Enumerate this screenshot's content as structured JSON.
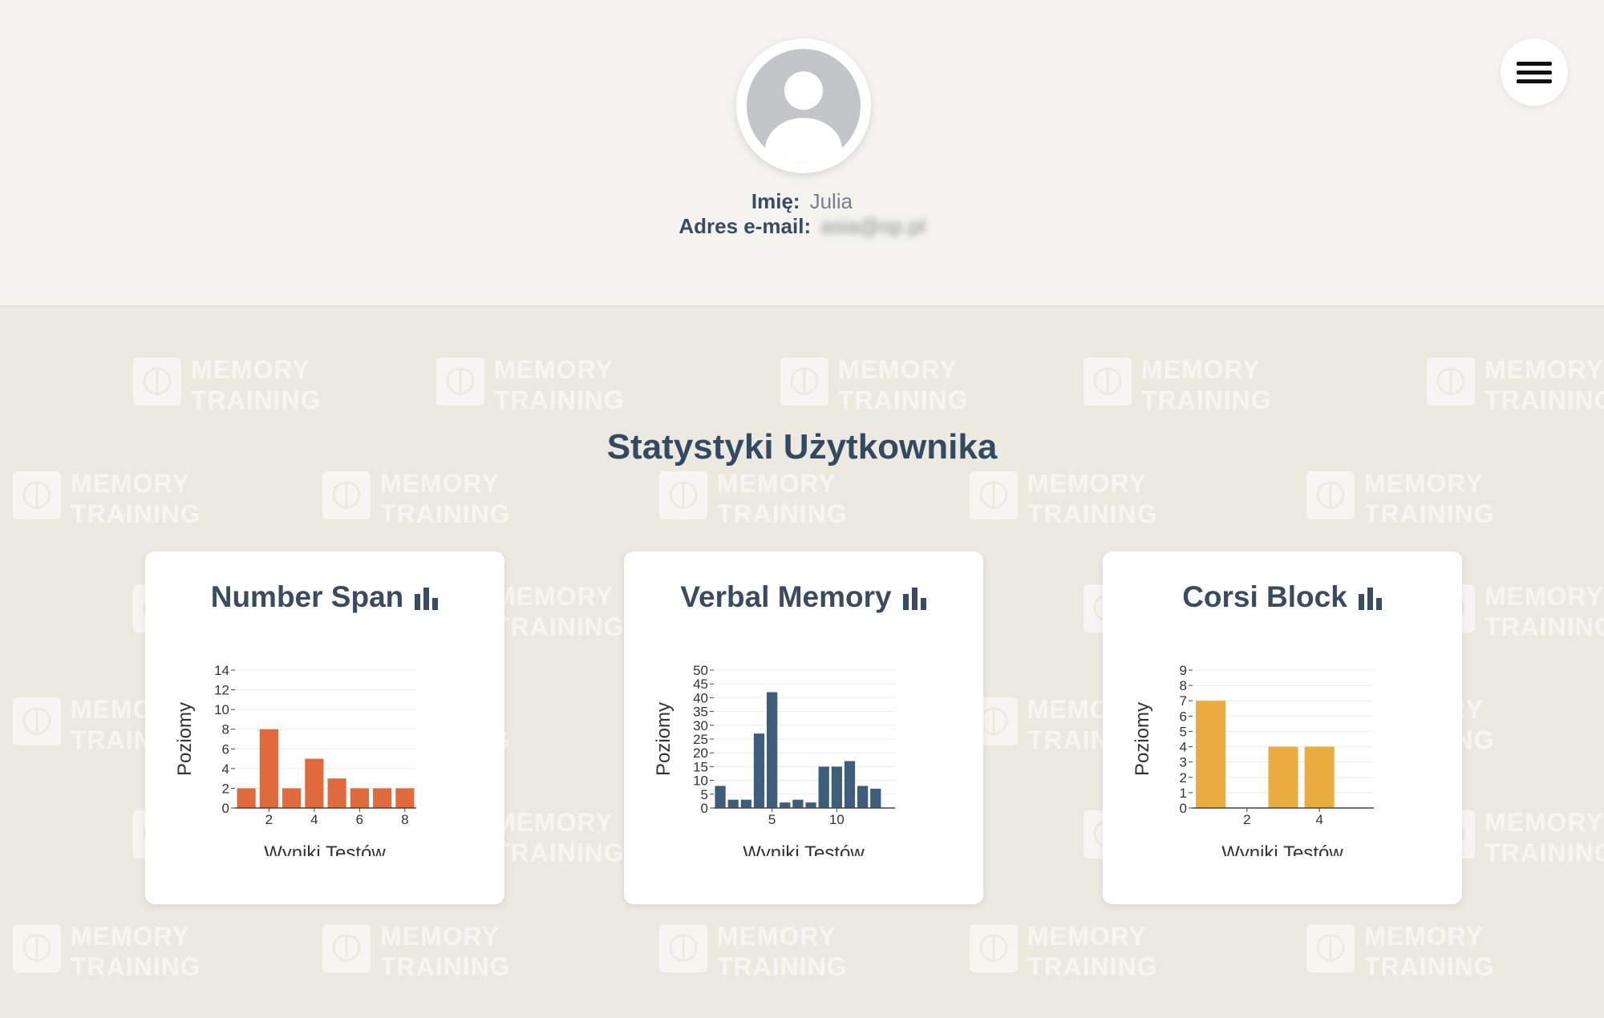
{
  "header": {
    "avatar": "default-user-avatar",
    "menu_icon": "hamburger-menu-icon",
    "name_label": "Imię:",
    "name_value": "Julia",
    "email_label": "Adres e-mail:",
    "email_value": "asia@op.pl"
  },
  "watermark": {
    "line1": "MEMORY",
    "line2": "TRAINING",
    "icon": "brain-icon"
  },
  "stats": {
    "title": "Statystyki Użytkownika"
  },
  "cards": [
    {
      "title": "Number Span",
      "icon": "bar-chart-icon"
    },
    {
      "title": "Verbal Memory",
      "icon": "bar-chart-icon"
    },
    {
      "title": "Corsi Block",
      "icon": "bar-chart-icon"
    }
  ],
  "chart_data": [
    {
      "type": "bar",
      "xlabel": "Wyniki Testów",
      "ylabel": "Poziomy",
      "color": "#e06a3c",
      "x": [
        1,
        2,
        3,
        4,
        5,
        6,
        7,
        8
      ],
      "values": [
        2,
        8,
        2,
        5,
        3,
        2,
        2,
        2
      ],
      "xlim": [
        0.5,
        8.5
      ],
      "ylim": [
        0,
        14
      ],
      "xticks": [
        2,
        4,
        6,
        8
      ],
      "yticks": [
        0,
        2,
        4,
        6,
        8,
        10,
        12,
        14
      ],
      "grid": true
    },
    {
      "type": "bar",
      "xlabel": "Wyniki Testów",
      "ylabel": "Poziomy",
      "color": "#3e5d7a",
      "x": [
        1,
        2,
        3,
        4,
        5,
        6,
        7,
        8,
        9,
        10,
        11,
        12,
        13,
        14
      ],
      "values": [
        8,
        3,
        3,
        27,
        42,
        2,
        3,
        2,
        15,
        15,
        17,
        8,
        7
      ],
      "xlim": [
        0.5,
        14.5
      ],
      "ylim": [
        0,
        50
      ],
      "xticks": [
        5,
        10
      ],
      "yticks": [
        0,
        5,
        10,
        15,
        20,
        25,
        30,
        35,
        40,
        45,
        50
      ],
      "grid": true
    },
    {
      "type": "bar",
      "xlabel": "Wyniki Testów",
      "ylabel": "Poziomy",
      "color": "#ebac3f",
      "x": [
        1,
        2,
        3,
        4,
        5
      ],
      "values": [
        7,
        0,
        4,
        4,
        0
      ],
      "xlim": [
        0.5,
        5.5
      ],
      "ylim": [
        0,
        9
      ],
      "xticks": [
        2,
        4
      ],
      "yticks": [
        0,
        1,
        2,
        3,
        4,
        5,
        6,
        7,
        8,
        9
      ],
      "grid": true
    }
  ]
}
